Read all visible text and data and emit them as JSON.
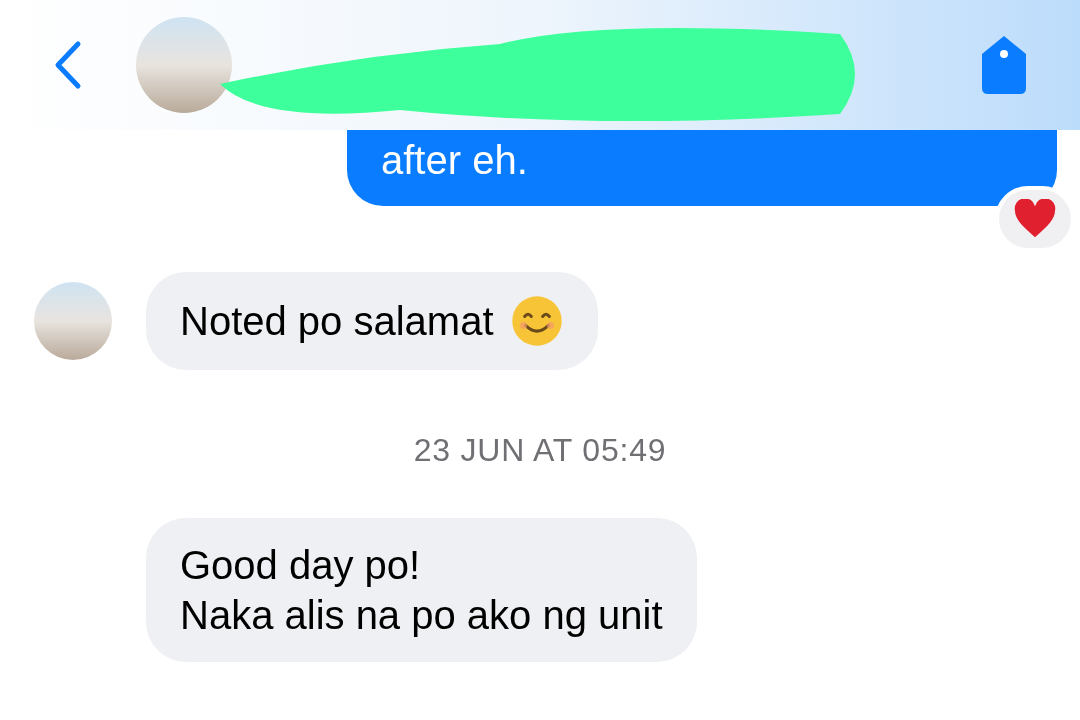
{
  "messages": [
    {
      "kind": "sent",
      "lines": [
        "after eh."
      ],
      "heart_reaction": true
    },
    {
      "kind": "received",
      "lines": [
        "Noted po salamat"
      ],
      "smile_emoji": true,
      "show_avatar": true
    },
    {
      "kind": "timestamp",
      "lines": [
        "23 JUN AT 05:49"
      ]
    },
    {
      "kind": "received",
      "lines": [
        "Good day po!",
        "Naka alis na po ako ng unit"
      ],
      "show_avatar": false
    }
  ]
}
